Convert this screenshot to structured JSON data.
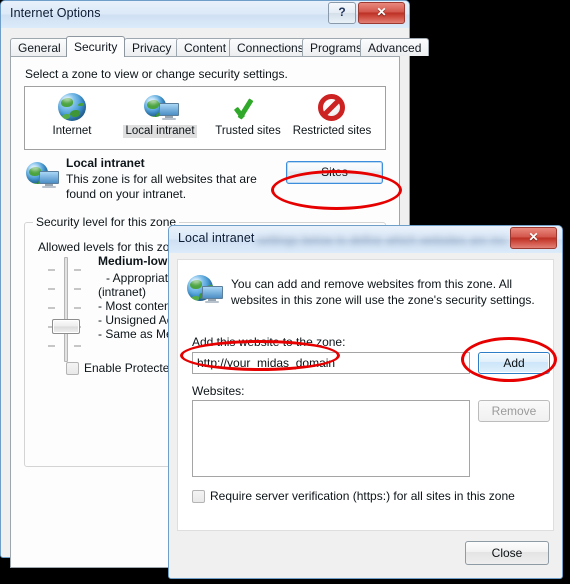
{
  "internet_options": {
    "title": "Internet Options",
    "help_button": "?",
    "close_button": "✕",
    "tabs": [
      {
        "label": "General",
        "active": false
      },
      {
        "label": "Security",
        "active": true
      },
      {
        "label": "Privacy",
        "active": false
      },
      {
        "label": "Content",
        "active": false
      },
      {
        "label": "Connections",
        "active": false
      },
      {
        "label": "Programs",
        "active": false
      },
      {
        "label": "Advanced",
        "active": false
      }
    ],
    "zone_prompt": "Select a zone to view or change security settings.",
    "zones": [
      {
        "label": "Internet",
        "icon": "globe-icon",
        "selected": false
      },
      {
        "label": "Local intranet",
        "icon": "globe-monitor-icon",
        "selected": true
      },
      {
        "label": "Trusted sites",
        "icon": "green-check-icon",
        "selected": false
      },
      {
        "label": "Restricted sites",
        "icon": "no-entry-icon",
        "selected": false
      }
    ],
    "selected_zone": {
      "name": "Local intranet",
      "description": "This zone is for all websites that are found on your intranet.",
      "icon": "globe-monitor-icon"
    },
    "sites_button": "Sites",
    "security_level_group": "Security level for this zone",
    "allowed_levels_label": "Allowed levels for this zone",
    "level_name_bold": "Medium-low",
    "level_name_suffix": "",
    "level_details": [
      "- Appropriate",
      "(intranet)",
      "- Most conten",
      "- Unsigned Ac",
      "- Same as Me"
    ],
    "protected_mode_label": "Enable Protected Mo",
    "protected_mode_checked": false
  },
  "local_intranet": {
    "title": "Local intranet",
    "title_blurred_suffix": "settings below to define which websites are included",
    "close_button": "✕",
    "message": "You can add and remove websites from this zone. All websites in this zone will use the zone's security settings.",
    "icon": "globe-monitor-icon",
    "add_label_pre": "A",
    "add_label_underline": "d",
    "add_label_post": "d this website to the zone:",
    "add_label_full": "Add this website to the zone:",
    "website_input_value": "http://your_midas_domain",
    "add_button": "Add",
    "websites_label": "Websites:",
    "websites_items": [],
    "remove_button": "Remove",
    "remove_disabled": true,
    "require_https_label": "Require server verification (https:) for all sites in this zone",
    "require_https_checked": false,
    "close_bottom_button": "Close"
  },
  "annotations": {
    "color": "#e60000",
    "highlights": [
      {
        "name": "sites-button-highlight",
        "target": "Sites"
      },
      {
        "name": "website-input-highlight",
        "target": "http://your_midas_domain"
      },
      {
        "name": "add-button-highlight",
        "target": "Add"
      }
    ]
  }
}
